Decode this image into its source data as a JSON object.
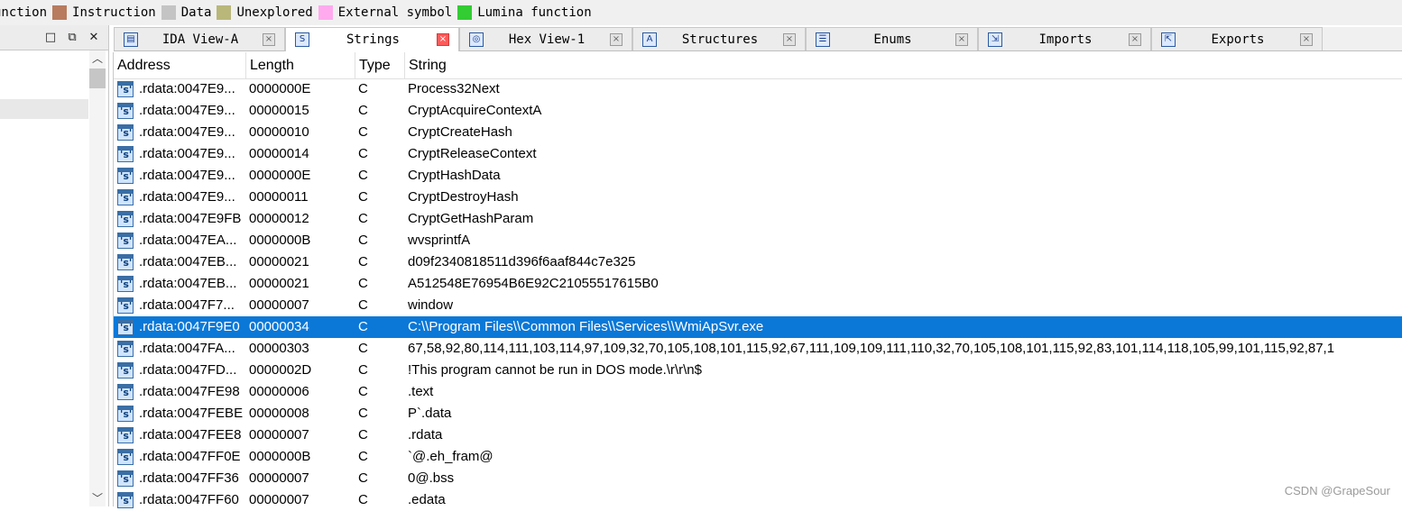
{
  "legend": [
    {
      "label": "unction",
      "color": "#ffffff"
    },
    {
      "label": "Instruction",
      "color": "#b87b5e"
    },
    {
      "label": "Data",
      "color": "#c4c4c4"
    },
    {
      "label": "Unexplored",
      "color": "#b9b77a"
    },
    {
      "label": "External symbol",
      "color": "#ffaaee"
    },
    {
      "label": "Lumina function",
      "color": "#33cc33"
    }
  ],
  "left_pane": {
    "buttons": [
      "□",
      "⧉",
      "✕"
    ]
  },
  "tabs": [
    {
      "label": "IDA View-A",
      "icon": "ida-view-icon",
      "active": false
    },
    {
      "label": "Strings",
      "icon": "strings-icon",
      "active": true
    },
    {
      "label": "Hex View-1",
      "icon": "hex-view-icon",
      "active": false
    },
    {
      "label": "Structures",
      "icon": "structures-icon",
      "active": false
    },
    {
      "label": "Enums",
      "icon": "enums-icon",
      "active": false
    },
    {
      "label": "Imports",
      "icon": "imports-icon",
      "active": false
    },
    {
      "label": "Exports",
      "icon": "exports-icon",
      "active": false
    }
  ],
  "strings_table": {
    "columns": [
      "Address",
      "Length",
      "Type",
      "String"
    ],
    "rows": [
      {
        "address": ".rdata:0047E9...",
        "length": "0000000E",
        "type": "C",
        "string": "Process32Next"
      },
      {
        "address": ".rdata:0047E9...",
        "length": "00000015",
        "type": "C",
        "string": "CryptAcquireContextA"
      },
      {
        "address": ".rdata:0047E9...",
        "length": "00000010",
        "type": "C",
        "string": "CryptCreateHash"
      },
      {
        "address": ".rdata:0047E9...",
        "length": "00000014",
        "type": "C",
        "string": "CryptReleaseContext"
      },
      {
        "address": ".rdata:0047E9...",
        "length": "0000000E",
        "type": "C",
        "string": "CryptHashData"
      },
      {
        "address": ".rdata:0047E9...",
        "length": "00000011",
        "type": "C",
        "string": "CryptDestroyHash"
      },
      {
        "address": ".rdata:0047E9FB",
        "length": "00000012",
        "type": "C",
        "string": "CryptGetHashParam"
      },
      {
        "address": ".rdata:0047EA...",
        "length": "0000000B",
        "type": "C",
        "string": "wvsprintfA"
      },
      {
        "address": ".rdata:0047EB...",
        "length": "00000021",
        "type": "C",
        "string": "d09f2340818511d396f6aaf844c7e325"
      },
      {
        "address": ".rdata:0047EB...",
        "length": "00000021",
        "type": "C",
        "string": "A512548E76954B6E92C21055517615B0"
      },
      {
        "address": ".rdata:0047F7...",
        "length": "00000007",
        "type": "C",
        "string": "window"
      },
      {
        "address": ".rdata:0047F9E0",
        "length": "00000034",
        "type": "C",
        "string": "C:\\\\Program Files\\\\Common Files\\\\Services\\\\WmiApSvr.exe",
        "selected": true
      },
      {
        "address": ".rdata:0047FA...",
        "length": "00000303",
        "type": "C",
        "string": "67,58,92,80,114,111,103,114,97,109,32,70,105,108,101,115,92,67,111,109,109,111,110,32,70,105,108,101,115,92,83,101,114,118,105,99,101,115,92,87,1"
      },
      {
        "address": ".rdata:0047FD...",
        "length": "0000002D",
        "type": "C",
        "string": "!This program cannot be run in DOS mode.\\r\\r\\n$"
      },
      {
        "address": ".rdata:0047FE98",
        "length": "00000006",
        "type": "C",
        "string": ".text"
      },
      {
        "address": ".rdata:0047FEBE",
        "length": "00000008",
        "type": "C",
        "string": "P`.data"
      },
      {
        "address": ".rdata:0047FEE8",
        "length": "00000007",
        "type": "C",
        "string": ".rdata"
      },
      {
        "address": ".rdata:0047FF0E",
        "length": "0000000B",
        "type": "C",
        "string": "`@.eh_fram@"
      },
      {
        "address": ".rdata:0047FF36",
        "length": "00000007",
        "type": "C",
        "string": "0@.bss"
      },
      {
        "address": ".rdata:0047FF60",
        "length": "00000007",
        "type": "C",
        "string": ".edata"
      }
    ]
  },
  "watermark": "CSDN @GrapeSour",
  "colors": {
    "selection": "#0b78d7",
    "active_tab_close": "#ff5a5a"
  }
}
